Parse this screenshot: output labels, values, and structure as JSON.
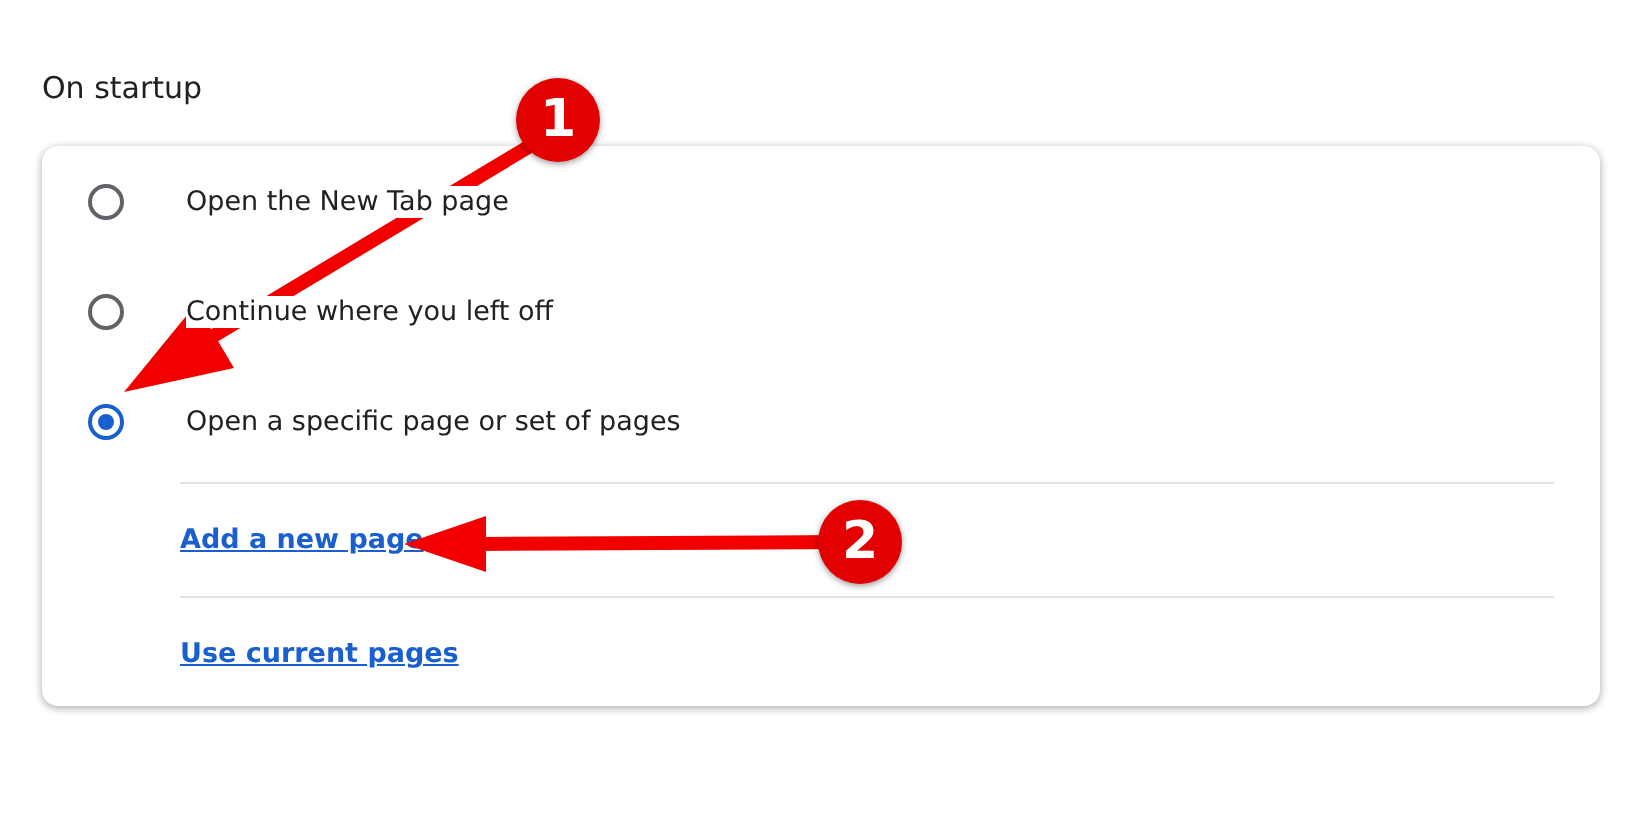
{
  "section": {
    "title": "On startup"
  },
  "options": [
    {
      "label": "Open the New Tab page",
      "selected": false
    },
    {
      "label": "Continue where you left off",
      "selected": false
    },
    {
      "label": "Open a specific page or set of pages",
      "selected": true
    }
  ],
  "links": [
    "Add a new page",
    "Use current pages"
  ],
  "annotations": [
    {
      "number": "1",
      "kind": "diagonal"
    },
    {
      "number": "2",
      "kind": "horizontal"
    }
  ]
}
